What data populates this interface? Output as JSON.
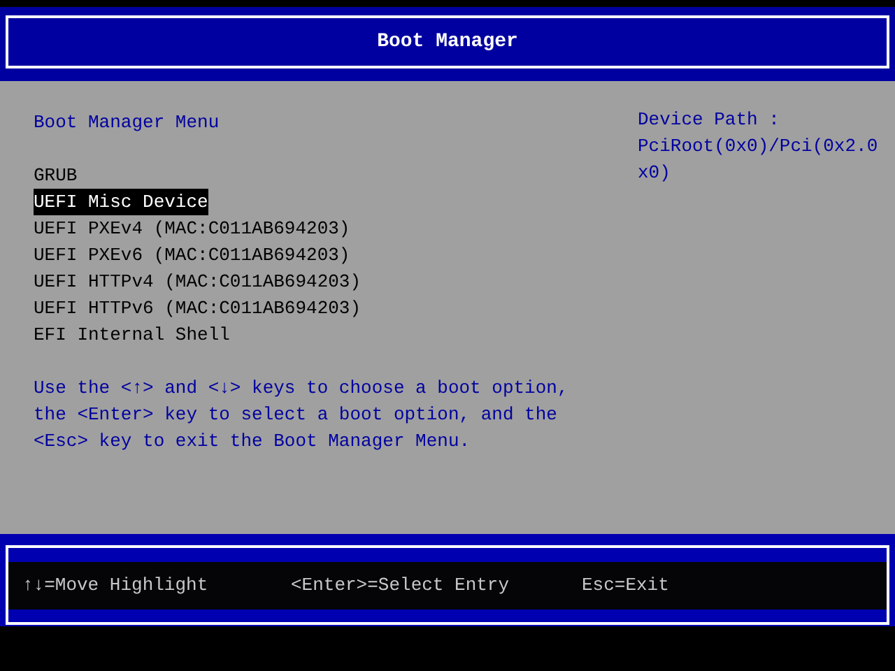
{
  "header": {
    "title": "Boot Manager"
  },
  "menu": {
    "title": "Boot Manager Menu",
    "items": [
      {
        "label": "GRUB",
        "selected": false
      },
      {
        "label": "UEFI Misc Device",
        "selected": true
      },
      {
        "label": "UEFI PXEv4 (MAC:C011AB694203)",
        "selected": false
      },
      {
        "label": "UEFI PXEv6 (MAC:C011AB694203)",
        "selected": false
      },
      {
        "label": "UEFI HTTPv4 (MAC:C011AB694203)",
        "selected": false
      },
      {
        "label": "UEFI HTTPv6 (MAC:C011AB694203)",
        "selected": false
      },
      {
        "label": "EFI Internal Shell",
        "selected": false
      }
    ],
    "help": "Use the <↑> and <↓> keys to choose a boot option, the <Enter> key to select a boot option, and the <Esc> key to exit the Boot Manager Menu."
  },
  "device_path": {
    "label": "Device Path :",
    "value": "PciRoot(0x0)/Pci(0x2.0x0)"
  },
  "status_bar": [
    "↑↓=Move Highlight",
    "<Enter>=Select Entry",
    "Esc=Exit"
  ]
}
